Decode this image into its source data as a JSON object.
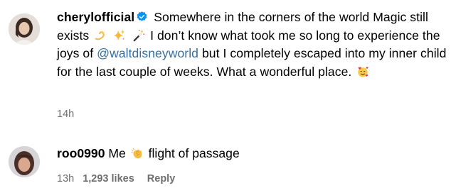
{
  "post": {
    "username": "cherylofficial",
    "text_part1": "Somewhere in the corners of the world Magic still exists",
    "text_part2": "I don’t know what took me so long to experience the joys of",
    "mention": "@waltdisneyworld",
    "text_part3": "but I completely escaped into my inner child for the last couple of weeks. What a wonderful place.",
    "time": "14h",
    "emojis": [
      "dizzy-icon",
      "sparkles-icon",
      "magic-wand-icon",
      "smiling-face-with-hearts-icon"
    ]
  },
  "comment": {
    "username": "roo0990",
    "text_before": "Me",
    "text_after": "flight of passage",
    "time": "13h",
    "likes": "1,293 likes",
    "reply_label": "Reply",
    "emojis": [
      "clapping-hands-icon"
    ]
  },
  "colors": {
    "mention": "#376fa0",
    "meta": "#6e6e6e",
    "verified": "#0095f6"
  }
}
